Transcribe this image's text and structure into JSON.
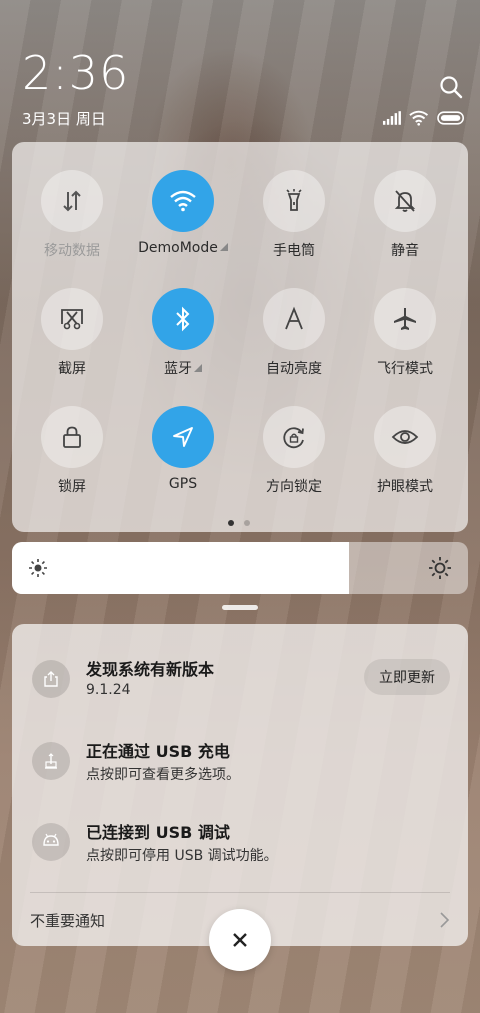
{
  "status": {
    "time": "2:36",
    "date": "3月3日 周日"
  },
  "quick_settings": {
    "tiles": [
      {
        "label": "移动数据",
        "icon": "mobile-data-icon",
        "active": false,
        "disabled": true
      },
      {
        "label": "DemoMode",
        "icon": "wifi-icon",
        "active": true
      },
      {
        "label": "手电筒",
        "icon": "flashlight-icon",
        "active": false
      },
      {
        "label": "静音",
        "icon": "mute-bell-icon",
        "active": false
      },
      {
        "label": "截屏",
        "icon": "screenshot-icon",
        "active": false
      },
      {
        "label": "蓝牙",
        "icon": "bluetooth-icon",
        "active": true
      },
      {
        "label": "自动亮度",
        "icon": "auto-brightness-icon",
        "active": false
      },
      {
        "label": "飞行模式",
        "icon": "airplane-icon",
        "active": false
      },
      {
        "label": "锁屏",
        "icon": "lock-icon",
        "active": false
      },
      {
        "label": "GPS",
        "icon": "gps-icon",
        "active": true
      },
      {
        "label": "方向锁定",
        "icon": "rotation-lock-icon",
        "active": false
      },
      {
        "label": "护眼模式",
        "icon": "eye-icon",
        "active": false
      }
    ],
    "pages": 2,
    "current_page": 1
  },
  "brightness": {
    "level": 0.74
  },
  "notifications": {
    "items": [
      {
        "title": "发现系统有新版本",
        "subtitle": "9.1.24",
        "icon": "upload-icon",
        "action": "立即更新"
      },
      {
        "title": "正在通过 USB 充电",
        "subtitle": "点按即可查看更多选项。",
        "icon": "usb-charging-icon"
      },
      {
        "title": "已连接到 USB 调试",
        "subtitle": "点按即可停用 USB 调试功能。",
        "icon": "android-debug-icon"
      }
    ],
    "unimportant_label": "不重要通知"
  },
  "colors": {
    "accent": "#32a4e8"
  }
}
